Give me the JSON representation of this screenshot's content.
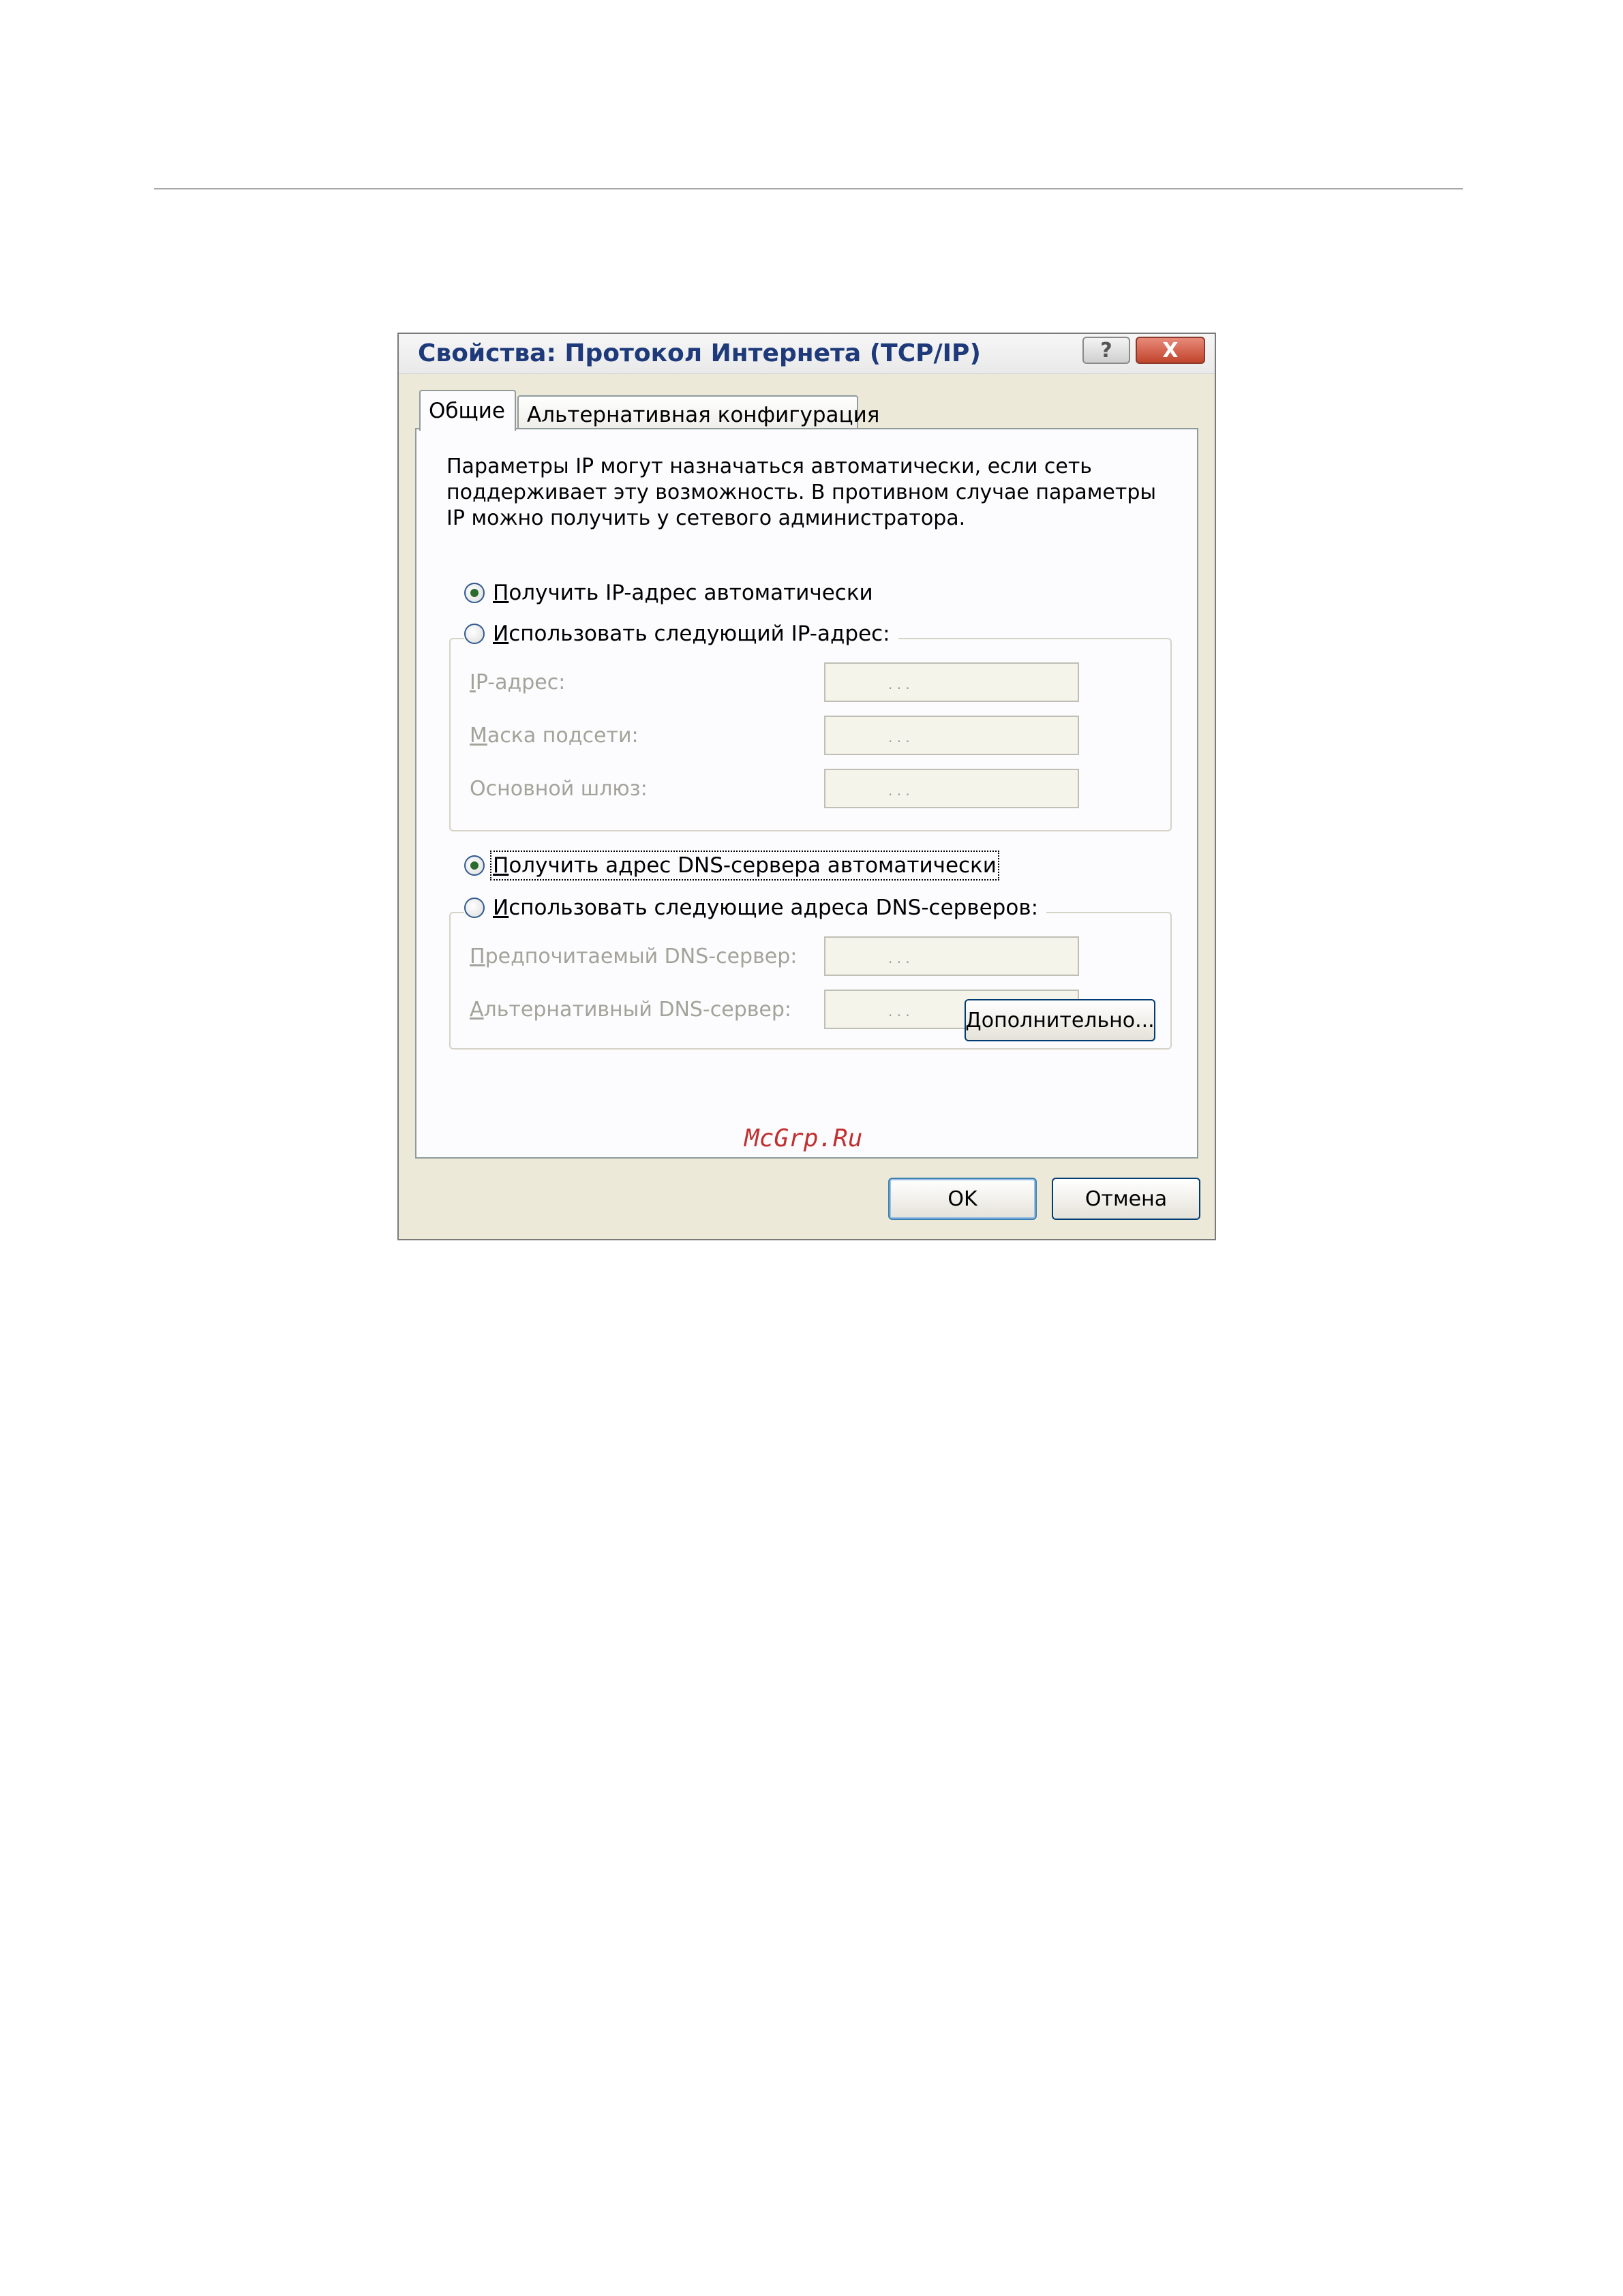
{
  "dialog": {
    "title": "Свойства: Протокол Интернета (TCP/IP)",
    "help_glyph": "?",
    "close_glyph": "X"
  },
  "tabs": [
    {
      "label": "Общие",
      "selected": true
    },
    {
      "label": "Альтернативная конфигурация",
      "selected": false
    }
  ],
  "general": {
    "description": "Параметры IP могут назначаться автоматически, если сеть поддерживает эту возможность. В противном случае параметры IP можно получить у сетевого администратора.",
    "ip_auto": {
      "mnemonic": "П",
      "rest": "олучить IP-адрес автоматически",
      "checked": true
    },
    "ip_manual": {
      "mnemonic": "И",
      "rest": "спользовать следующий IP-адрес:",
      "checked": false
    },
    "ip_fields": [
      {
        "mnemonic": "I",
        "rest": "P-адрес:",
        "value": ". . ."
      },
      {
        "mnemonic": "М",
        "rest": "аска подсети:",
        "value": ". . ."
      },
      {
        "mnemonic": "",
        "rest": "Основной шлюз:",
        "value": ". . ."
      }
    ],
    "dns_auto": {
      "mnemonic": "П",
      "rest": "олучить адрес DNS-сервера автоматически",
      "checked": true
    },
    "dns_manual": {
      "mnemonic": "И",
      "rest": "спользовать следующие адреса DNS-серверов:",
      "checked": false
    },
    "dns_fields": [
      {
        "mnemonic": "П",
        "rest": "редпочитаемый DNS-сервер:",
        "value": ". . ."
      },
      {
        "mnemonic": "А",
        "rest": "льтернативный DNS-сервер:",
        "value": ". . ."
      }
    ],
    "advanced_mnemonic": "Д",
    "advanced_rest": "ополнительно..."
  },
  "footer": {
    "ok_label": "OK",
    "cancel_label": "Отмена"
  },
  "watermark": "McGrp.Ru"
}
